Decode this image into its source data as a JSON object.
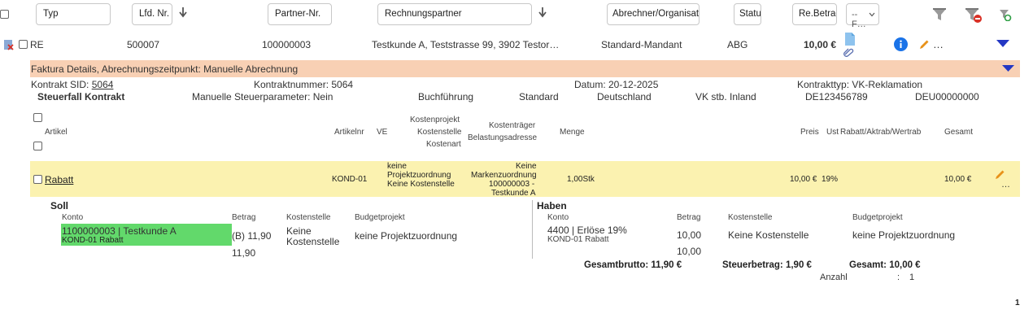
{
  "filters": {
    "typ": "Typ",
    "lfd_nr": "Lfd. Nr.",
    "partner_nr": "Partner-Nr.",
    "rechnungspartner": "Rechnungspartner",
    "abrechner": "Abrechner/Organisator",
    "status": "Status",
    "re_betrag": "Re.Betrag",
    "select_value": "-- F…"
  },
  "record": {
    "typ": "RE",
    "lfd_nr": "500007",
    "partner_nr": "100000003",
    "rechnungspartner": "Testkunde A, Teststrasse 99, 3902 Testor…",
    "mandant": "Standard-Mandant",
    "status": "ABG",
    "betrag": "10,00 €",
    "more": "…"
  },
  "faktura": {
    "title": "Faktura Details, Abrechnungszeitpunkt: Manuelle Abrechnung",
    "kontrakt_sid_label": "Kontrakt SID:",
    "kontrakt_sid": "5064",
    "kontraktnummer": "Kontraktnummer: 5064",
    "datum": "Datum: 20-12-2025",
    "kontrakttyp": "Kontrakttyp: VK-Reklamation",
    "steuerfall": "Steuerfall Kontrakt",
    "steuerparameter": "Manuelle Steuerparameter: Nein",
    "buchfuehrung": "Buchführung",
    "standard": "Standard",
    "land": "Deutschland",
    "vk_stb": "VK stb. Inland",
    "ust_id": "DE123456789",
    "deu_id": "DEU00000000"
  },
  "columns": {
    "artikel": "Artikel",
    "artikelnr": "Artikelnr",
    "ve": "VE",
    "kostenprojekt": "Kostenprojekt",
    "kostenstelle": "Kostenstelle",
    "kostenart": "Kostenart",
    "kostentraeger": "Kostenträger",
    "belastungsadresse": "Belastungsadresse",
    "menge": "Menge",
    "preis": "Preis",
    "ust": "Ust",
    "rabatt": "Rabatt/Aktrab/Wertrab",
    "gesamt": "Gesamt"
  },
  "article": {
    "name": "Rabatt",
    "artikelnr": "KOND-01",
    "kosten_1": "keine",
    "kosten_2": "Projektzuordnung",
    "kosten_3": "Keine Kostenstelle",
    "traeger_1": "Keine",
    "traeger_2": "Markenzuordnung",
    "traeger_3": "100000003 -",
    "traeger_4": "Testkunde A",
    "menge": "1,00Stk",
    "preis": "10,00 €",
    "ust": "19%",
    "gesamt": "10,00 €",
    "more": "…"
  },
  "soll": {
    "title": "Soll",
    "konto_label": "Konto",
    "betrag_label": "Betrag",
    "kostenstelle_label": "Kostenstelle",
    "budgetprojekt_label": "Budgetprojekt",
    "konto": "1100000003 | Testkunde A",
    "konto_sub": "KOND-01 Rabatt",
    "betrag": "(B) 11,90",
    "betrag_sum": "11,90",
    "kostenstelle_1": "Keine",
    "kostenstelle_2": "Kostenstelle",
    "budgetprojekt": "keine Projektzuordnung"
  },
  "haben": {
    "title": "Haben",
    "konto_label": "Konto",
    "betrag_label": "Betrag",
    "kostenstelle_label": "Kostenstelle",
    "budgetprojekt_label": "Budgetprojekt",
    "konto": "4400 | Erlöse 19%",
    "konto_sub": "KOND-01 Rabatt",
    "betrag": "10,00",
    "betrag_sum": "10,00",
    "kostenstelle": "Keine Kostenstelle",
    "budgetprojekt": "keine Projektzuordnung"
  },
  "totals": {
    "gesamtbrutto": "Gesamtbrutto: 11,90 €",
    "steuerbetrag": "Steuerbetrag: 1,90 €",
    "gesamt": "Gesamt: 10,00 €",
    "anzahl_label": "Anzahl",
    "anzahl_sep": ":",
    "anzahl": "1"
  },
  "pagination": {
    "page": "1"
  },
  "colors": {
    "faktura_bg": "#f8d0b4",
    "article_bg": "#fbf2b0",
    "konto_highlight": "#62d96b",
    "accent_blue": "#1a73e8",
    "edit_orange": "#e8921a"
  }
}
